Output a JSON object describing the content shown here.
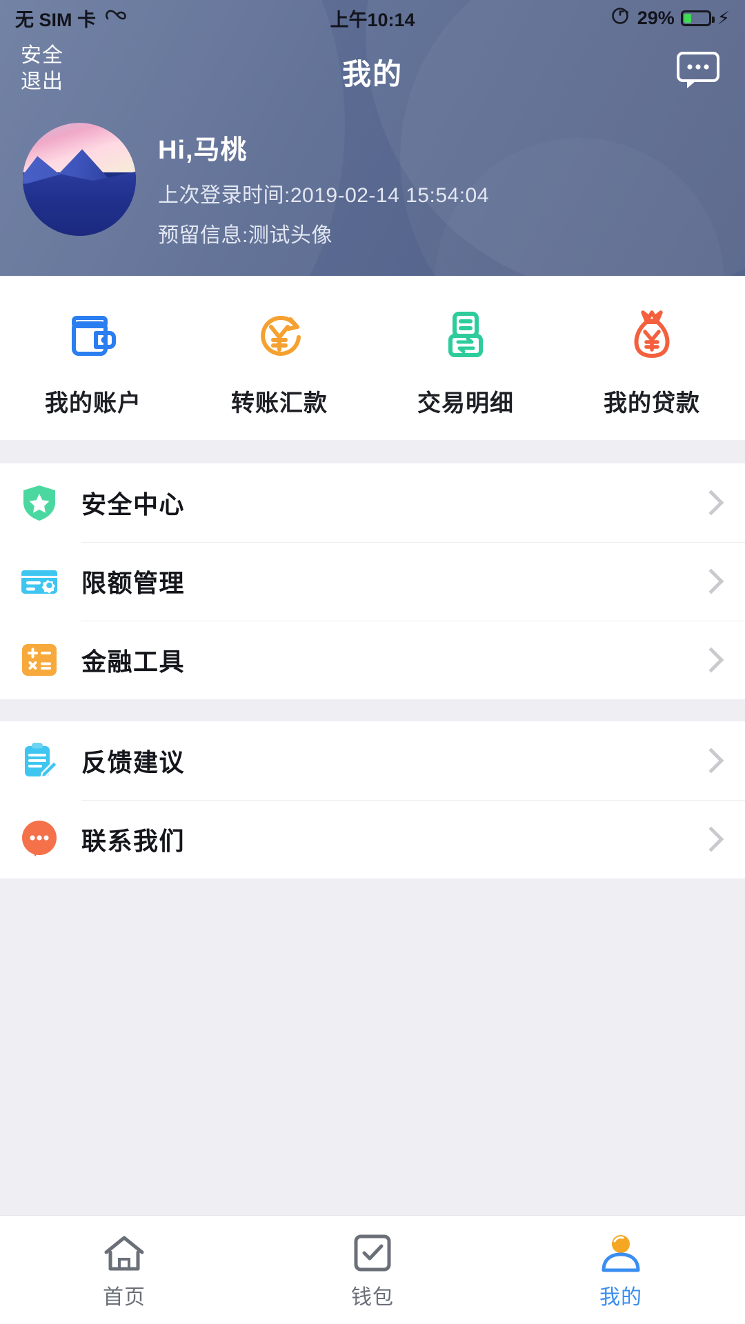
{
  "status_bar": {
    "carrier": "无 SIM 卡",
    "carrier_icon": "loop-icon",
    "time": "上午10:14",
    "rotation_lock_icon": "rotation-lock-icon",
    "battery_percent": "29%",
    "battery_level": 29,
    "charging_icon": "lightning-bolt-icon"
  },
  "header": {
    "logout_line1": "安全",
    "logout_line2": "退出",
    "title": "我的",
    "message_icon": "message-bubble-icon",
    "gradient_from": "#6c7da1",
    "gradient_to": "#4e5d85"
  },
  "profile": {
    "avatar_icon": "avatar-photo",
    "greeting": "Hi,马桃",
    "last_login": "上次登录时间:2019-02-14 15:54:04",
    "reserved_info": "预留信息:测试头像"
  },
  "quick_actions": [
    {
      "label": "我的账户",
      "icon": "wallet-icon",
      "color": "#2b7ef0"
    },
    {
      "label": "转账汇款",
      "icon": "transfer-yuan-icon",
      "color": "#f5a131"
    },
    {
      "label": "交易明细",
      "icon": "transaction-list-icon",
      "color": "#2ecc9b"
    },
    {
      "label": "我的贷款",
      "icon": "money-bag-icon",
      "color": "#f4603e"
    }
  ],
  "menu_groups": [
    {
      "items": [
        {
          "label": "安全中心",
          "icon": "shield-star-icon",
          "color": "#4ad8a0"
        },
        {
          "label": "限额管理",
          "icon": "card-gear-icon",
          "color": "#3ec6f0"
        },
        {
          "label": "金融工具",
          "icon": "calculator-icon",
          "color": "#f7a93b"
        }
      ]
    },
    {
      "items": [
        {
          "label": "反馈建议",
          "icon": "clipboard-pencil-icon",
          "color": "#3ec6f0"
        },
        {
          "label": "联系我们",
          "icon": "chat-circle-icon",
          "color": "#f4714a"
        }
      ]
    }
  ],
  "tabbar": {
    "active_color": "#3a8ef0",
    "items": [
      {
        "label": "首页",
        "icon": "home-icon",
        "active": false
      },
      {
        "label": "钱包",
        "icon": "wallet-check-icon",
        "active": false
      },
      {
        "label": "我的",
        "icon": "user-icon",
        "active": true
      }
    ]
  }
}
